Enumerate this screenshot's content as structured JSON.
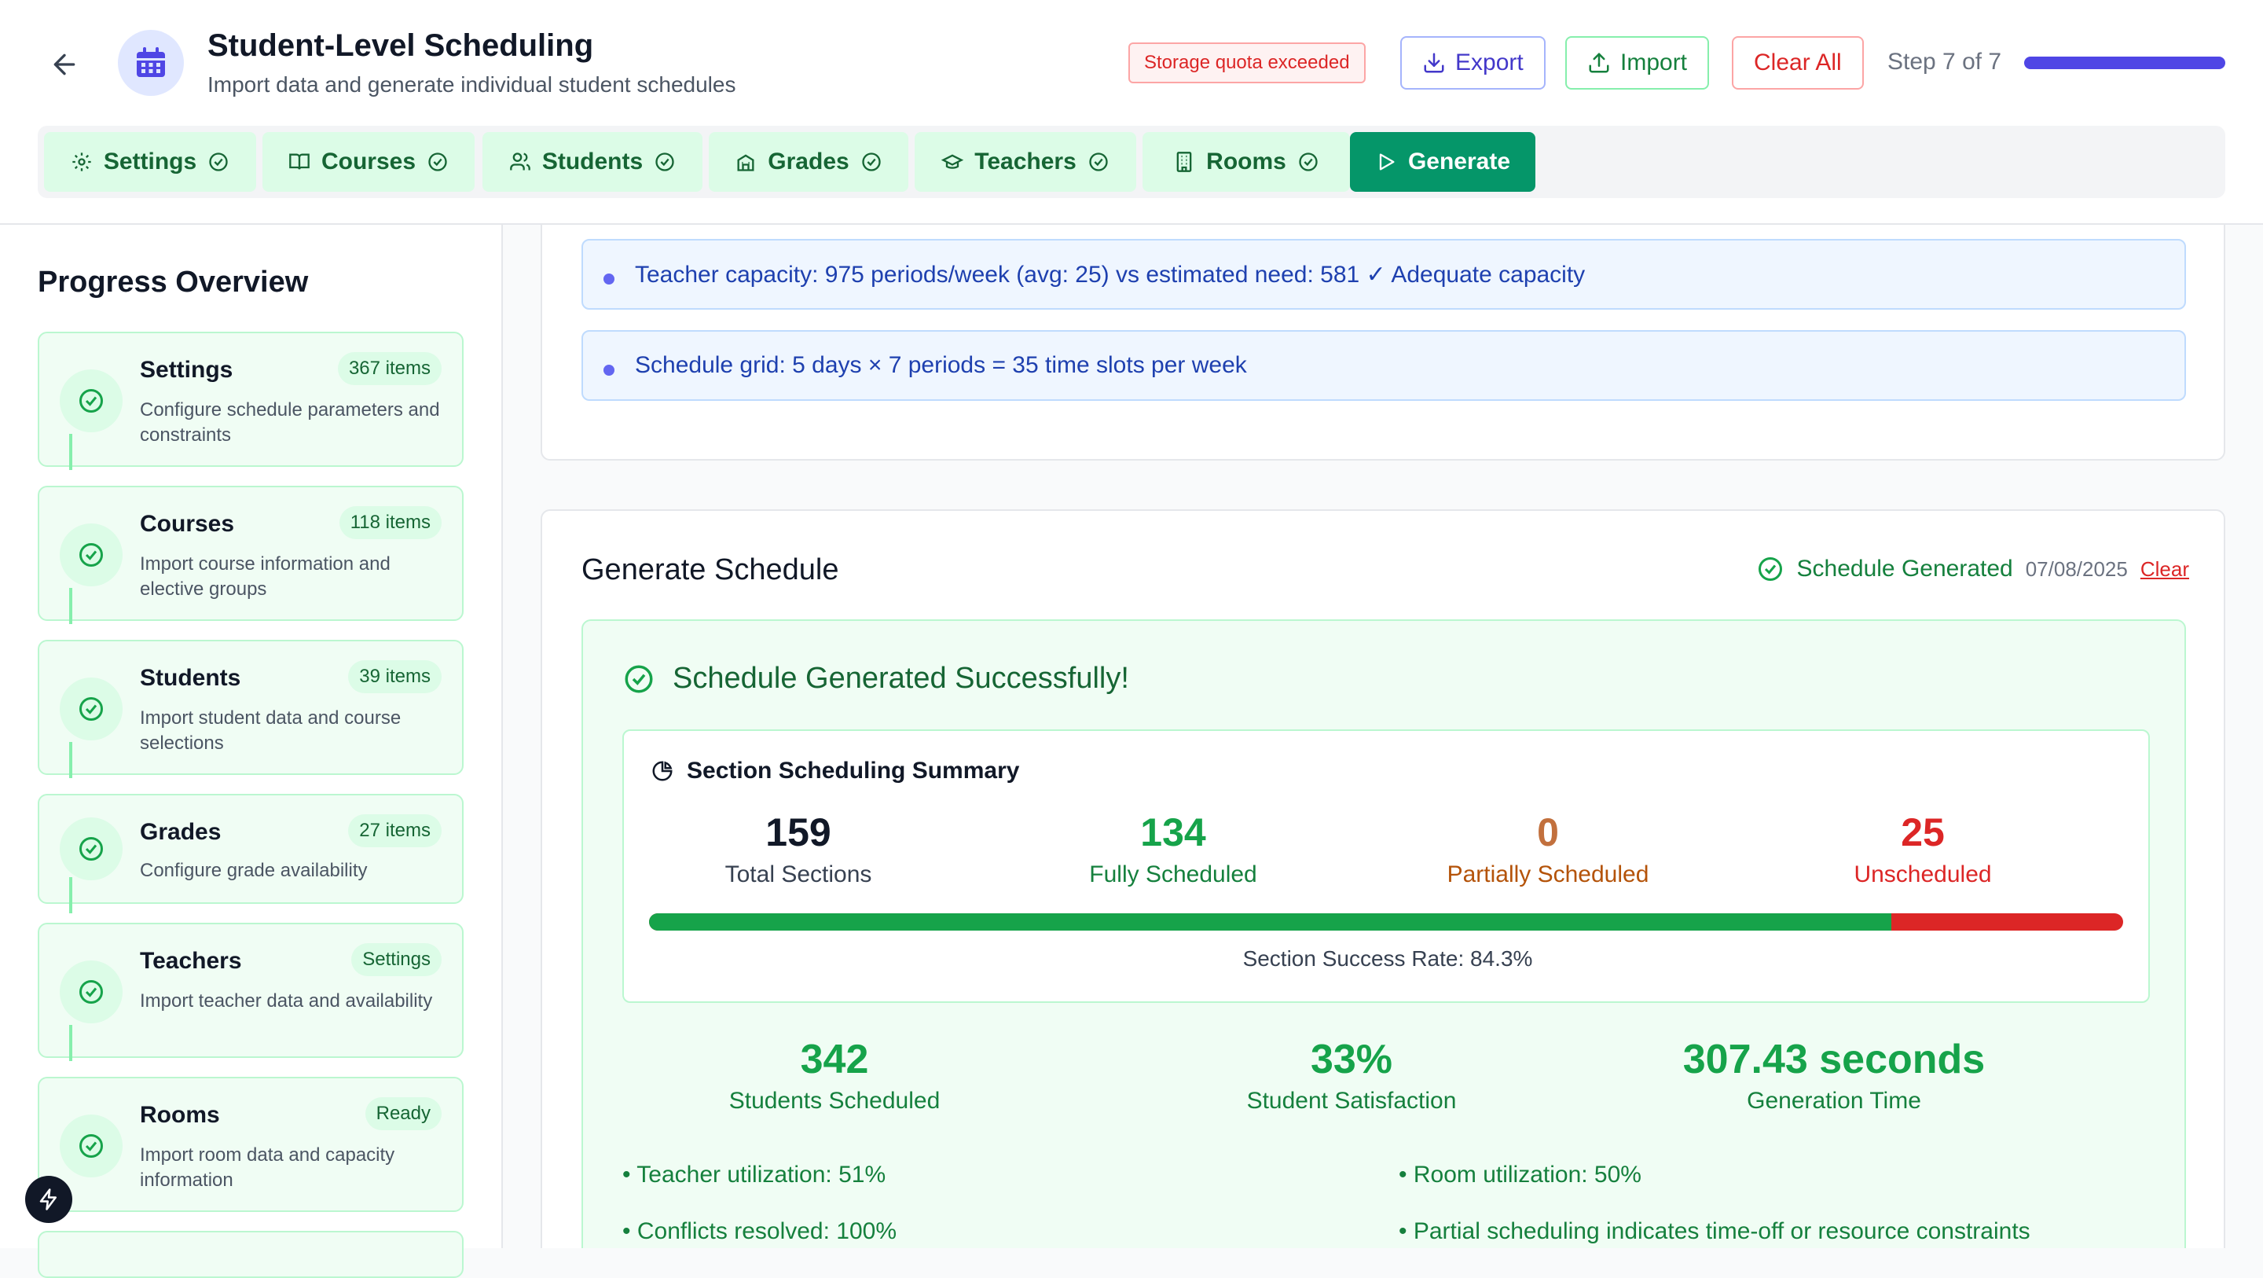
{
  "header": {
    "title": "Student-Level Scheduling",
    "subtitle": "Import data and generate individual student schedules",
    "quota_warning": "Storage quota exceeded",
    "export_label": "Export",
    "import_label": "Import",
    "clear_all_label": "Clear All",
    "step_text": "Step 7 of 7",
    "step_progress": 1.0,
    "accent_color": "#4f46e5"
  },
  "tabs": [
    {
      "label": "Settings",
      "icon": "gear-icon"
    },
    {
      "label": "Courses",
      "icon": "book-icon"
    },
    {
      "label": "Students",
      "icon": "users-icon"
    },
    {
      "label": "Grades",
      "icon": "school-icon"
    },
    {
      "label": "Teachers",
      "icon": "graduation-cap-icon"
    },
    {
      "label": "Rooms",
      "icon": "building-icon"
    },
    {
      "label": "Generate",
      "icon": "play-icon"
    }
  ],
  "sidebar": {
    "title": "Progress Overview",
    "items": [
      {
        "name": "Settings",
        "badge": "367 items",
        "desc": "Configure schedule parameters and constraints"
      },
      {
        "name": "Courses",
        "badge": "118 items",
        "desc": "Import course information and elective groups"
      },
      {
        "name": "Students",
        "badge": "39 items",
        "desc": "Import student data and course selections"
      },
      {
        "name": "Grades",
        "badge": "27 items",
        "desc": "Configure grade availability"
      },
      {
        "name": "Teachers",
        "badge": "Settings",
        "desc": "Import teacher data and availability"
      },
      {
        "name": "Rooms",
        "badge": "Ready",
        "desc": "Import room data and capacity information"
      }
    ]
  },
  "info_lines": [
    "Teacher capacity: 975 periods/week (avg: 25) vs estimated need: 581 ✓ Adequate capacity",
    "Schedule grid: 5 days × 7 periods = 35 time slots per week"
  ],
  "generate": {
    "title": "Generate Schedule",
    "status_label": "Schedule Generated",
    "date": "07/08/2025",
    "clear_label": "Clear",
    "success_title": "Schedule Generated Successfully!",
    "summary_title": "Section Scheduling Summary",
    "stats": [
      {
        "value": "159",
        "caption": "Total Sections",
        "color": "#111827",
        "cap_color": "#374151"
      },
      {
        "value": "134",
        "caption": "Fully Scheduled",
        "color": "#16a34a",
        "cap_color": "#15803d"
      },
      {
        "value": "0",
        "caption": "Partially Scheduled",
        "color": "#c2703d",
        "cap_color": "#b45309"
      },
      {
        "value": "25",
        "caption": "Unscheduled",
        "color": "#dc2626",
        "cap_color": "#dc2626"
      }
    ],
    "success_fraction": 0.843,
    "success_rate_text": "Section Success Rate: 84.3%",
    "big_stats": [
      {
        "value": "342",
        "caption": "Students Scheduled"
      },
      {
        "value": "33%",
        "caption": "Student Satisfaction"
      },
      {
        "value": "307.43 seconds",
        "caption": "Generation Time"
      }
    ],
    "notes": [
      "• Teacher utilization: 51%",
      "• Room utilization: 50%",
      "• Conflicts resolved: 100%",
      "• Partial scheduling indicates time-off or resource constraints"
    ]
  }
}
